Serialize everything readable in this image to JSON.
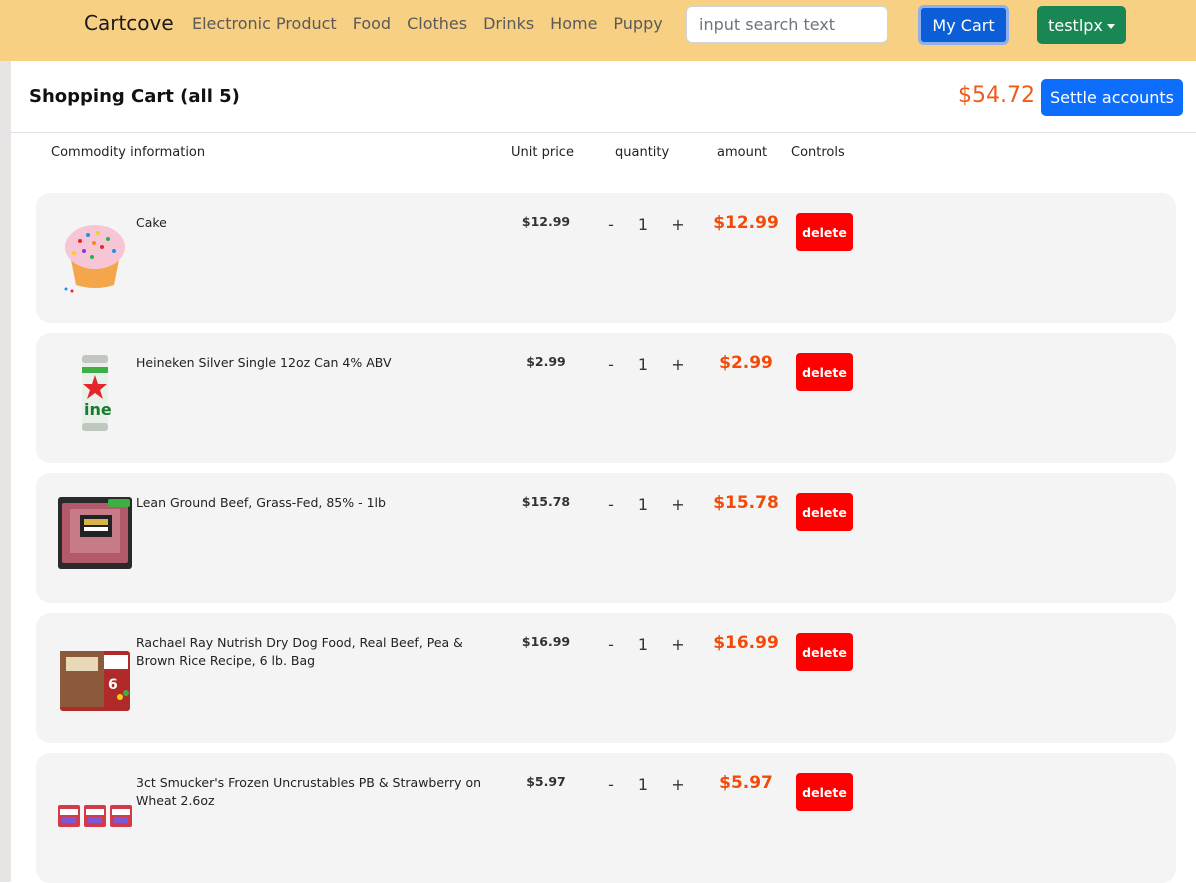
{
  "navbar": {
    "brand": "Cartcove",
    "links": [
      "Electronic Product",
      "Food",
      "Clothes",
      "Drinks",
      "Home",
      "Puppy"
    ],
    "search_placeholder": "input search text",
    "cart_label": "My Cart",
    "user_label": "testlpx"
  },
  "cart": {
    "title": "Shopping Cart (all 5)",
    "total": "$54.72",
    "settle_label": "Settle accounts",
    "columns": {
      "info": "Commodity information",
      "unit_price": "Unit price",
      "quantity": "quantity",
      "amount": "amount",
      "controls": "Controls"
    },
    "items": [
      {
        "name": "Cake",
        "price": "$12.99",
        "qty": "1",
        "amount": "$12.99",
        "icon": "cupcake-image"
      },
      {
        "name": "Heineken Silver Single 12oz Can 4% ABV",
        "price": "$2.99",
        "qty": "1",
        "amount": "$2.99",
        "icon": "beer-can-image"
      },
      {
        "name": "Lean Ground Beef, Grass-Fed, 85% - 1lb",
        "price": "$15.78",
        "qty": "1",
        "amount": "$15.78",
        "icon": "ground-beef-image"
      },
      {
        "name": "Rachael Ray Nutrish Dry Dog Food, Real Beef, Pea & Brown Rice Recipe, 6 lb. Bag",
        "price": "$16.99",
        "qty": "1",
        "amount": "$16.99",
        "icon": "dog-food-bag-image"
      },
      {
        "name": "3ct Smucker's Frozen Uncrustables PB & Strawberry on Wheat 2.6oz",
        "price": "$5.97",
        "qty": "1",
        "amount": "$5.97",
        "icon": "uncrustables-image"
      }
    ],
    "minus_label": "-",
    "plus_label": "+",
    "delete_label": "delete"
  },
  "colors": {
    "navbar_bg": "#f7d083",
    "primary": "#0d6efd",
    "success": "#198754",
    "price_accent": "#f24a0a",
    "danger": "#ff0000"
  }
}
